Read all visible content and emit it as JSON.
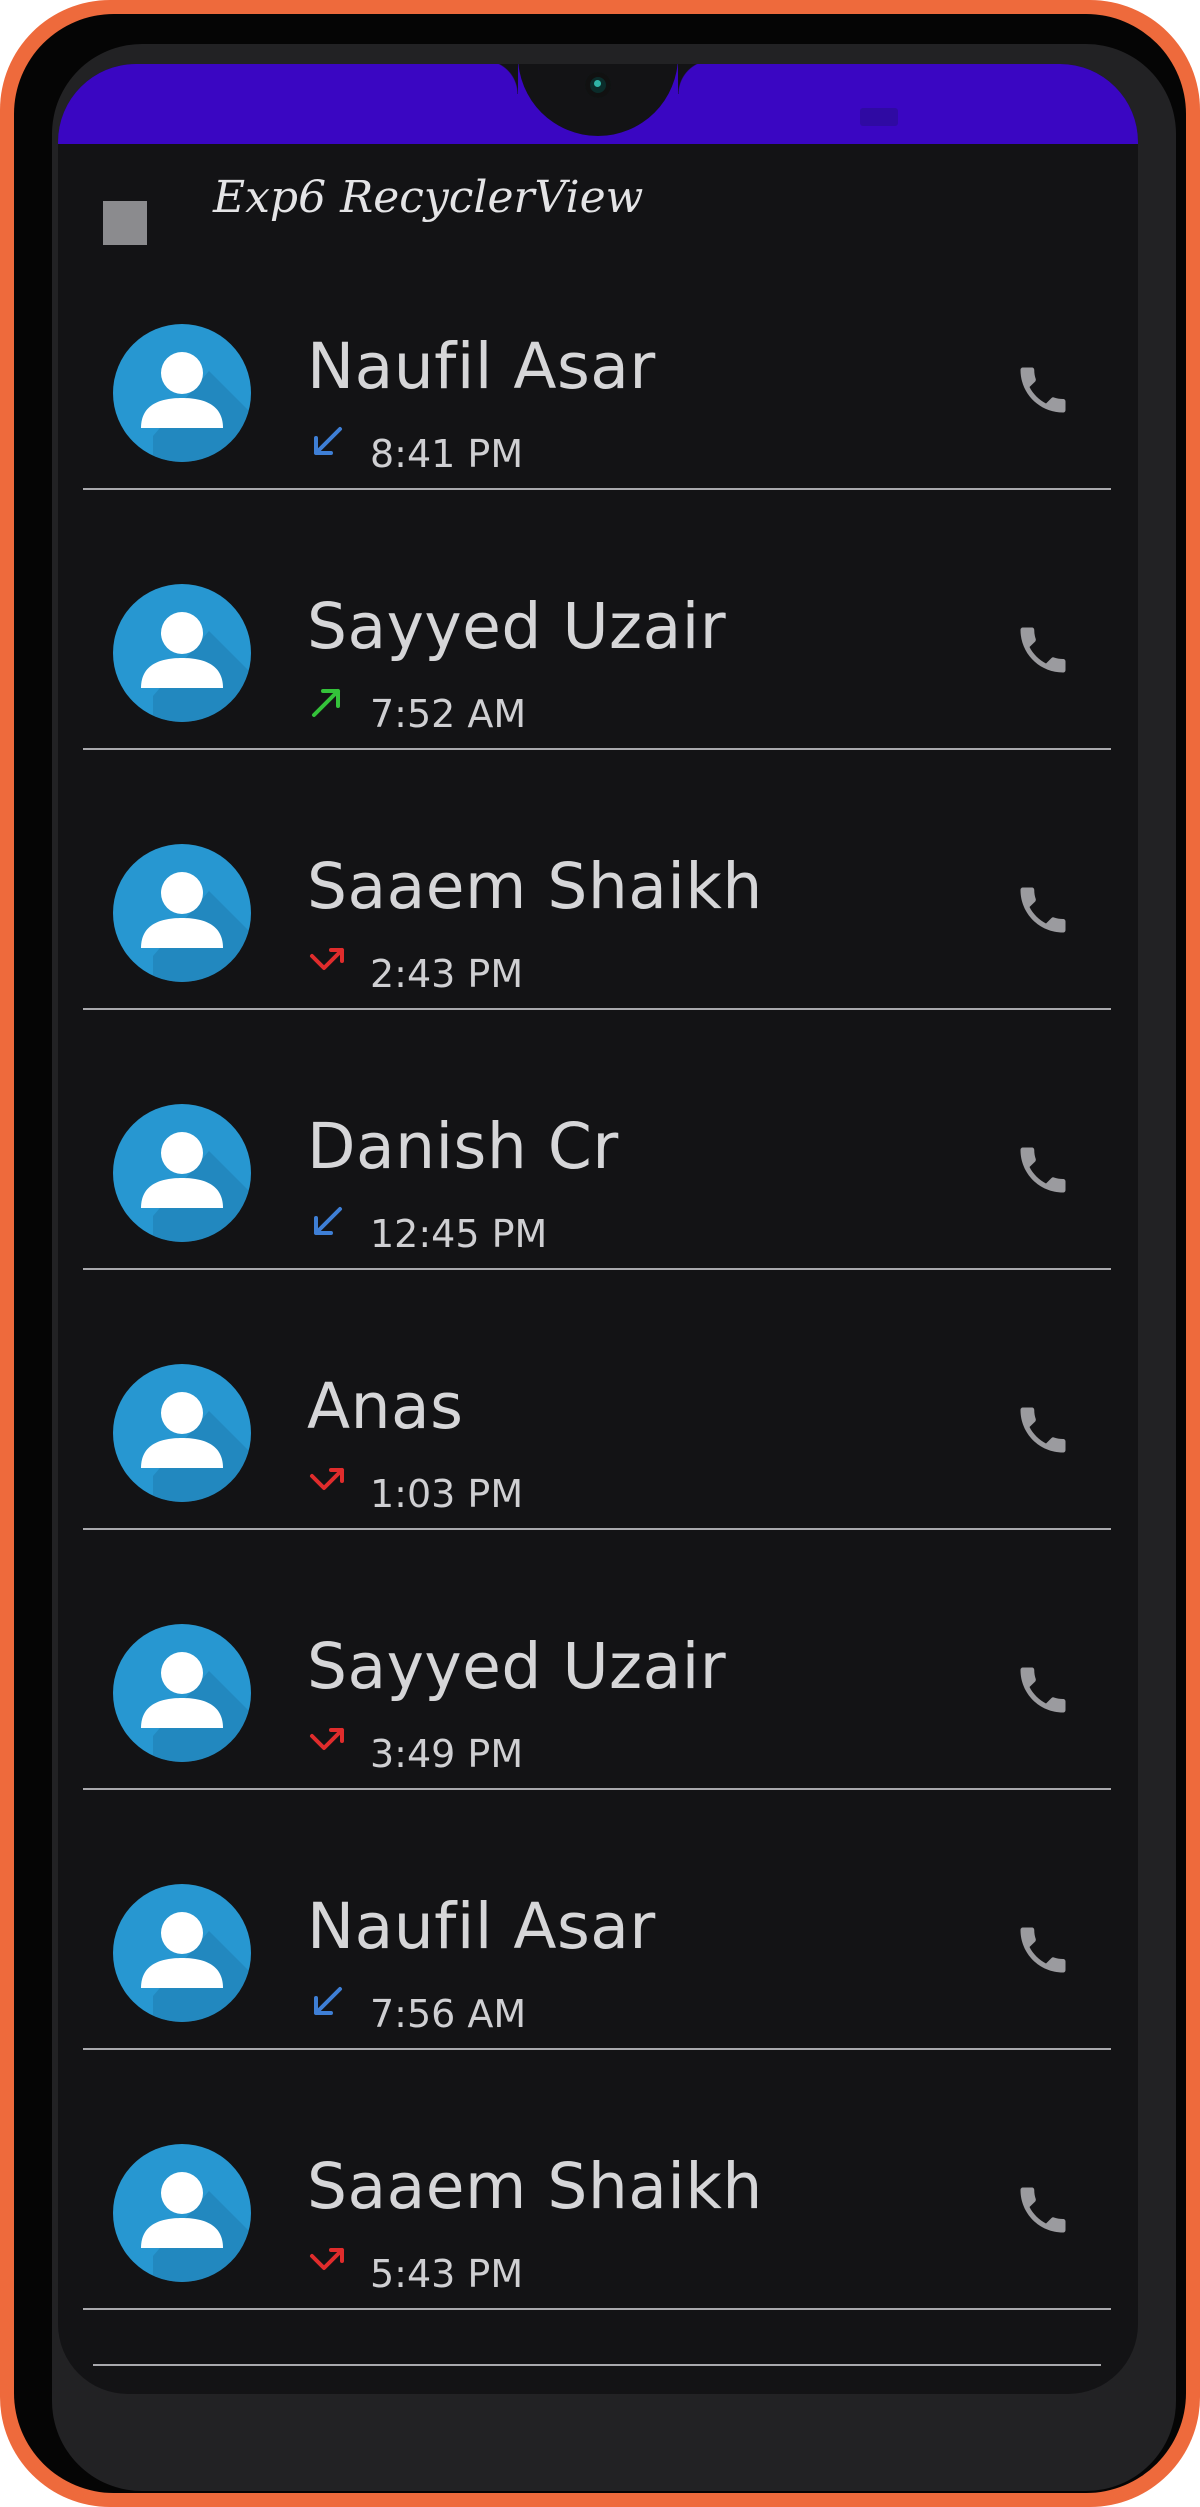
{
  "app": {
    "title": "Exp6 RecyclerView"
  },
  "colors": {
    "frame": "#ee6a3c",
    "status_bar": "#3a06c2",
    "background": "#131315",
    "avatar": "#2797d1",
    "incoming": "#3e7fd6",
    "outgoing": "#34c23a",
    "missed": "#e02c2c"
  },
  "icons": {
    "menu": "menu-square-icon",
    "avatar": "person-avatar-icon",
    "call": "phone-icon",
    "incoming": "incoming-call-arrow-icon",
    "outgoing": "outgoing-call-arrow-icon",
    "missed": "missed-call-arrow-icon"
  },
  "calls": [
    {
      "name": "Naufil Asar",
      "time": "8:41 PM",
      "type": "incoming"
    },
    {
      "name": "Sayyed Uzair",
      "time": "7:52 AM",
      "type": "outgoing"
    },
    {
      "name": "Saaem Shaikh",
      "time": "2:43 PM",
      "type": "missed"
    },
    {
      "name": "Danish Cr",
      "time": "12:45 PM",
      "type": "incoming"
    },
    {
      "name": "Anas",
      "time": "1:03 PM",
      "type": "missed"
    },
    {
      "name": "Sayyed Uzair",
      "time": "3:49 PM",
      "type": "missed"
    },
    {
      "name": "Naufil Asar",
      "time": "7:56 AM",
      "type": "incoming"
    },
    {
      "name": "Saaem Shaikh",
      "time": "5:43 PM",
      "type": "missed"
    }
  ]
}
